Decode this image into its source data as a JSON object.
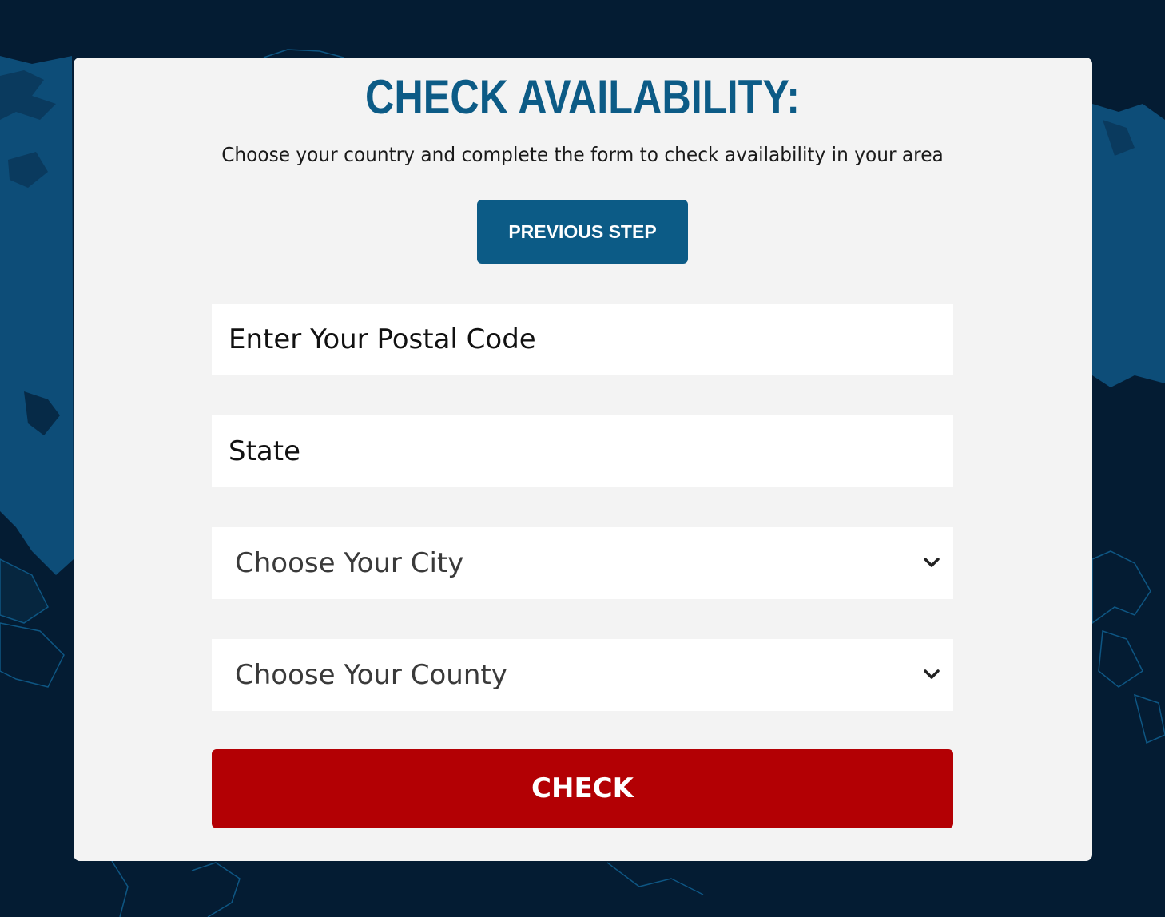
{
  "page": {
    "title": "CHECK AVAILABILITY:",
    "subtitle": "Choose your country and complete the form to check availability in your area",
    "background_color": "#041c33",
    "card_color": "#f3f3f3",
    "accent_color": "#0c5b86",
    "cta_color": "#b30004"
  },
  "buttons": {
    "previous_step": "PREVIOUS STEP",
    "check": "CHECK"
  },
  "form": {
    "postal_code": {
      "placeholder": "Enter Your Postal Code",
      "value": ""
    },
    "state": {
      "placeholder": "State",
      "value": ""
    },
    "city": {
      "selected": "Choose Your City",
      "icon": "chevron-down-icon"
    },
    "county": {
      "selected": "Choose Your County",
      "icon": "chevron-down-icon"
    }
  },
  "background": {
    "image": "world-map"
  }
}
